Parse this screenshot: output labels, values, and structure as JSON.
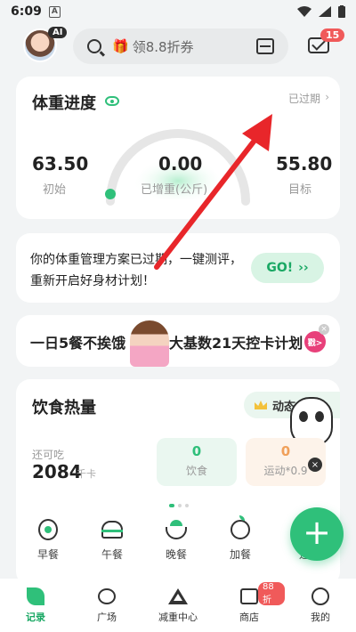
{
  "status_bar": {
    "time": "6:09"
  },
  "header": {
    "ai_badge": "AI",
    "search_placeholder": "领8.8折券",
    "mail_badge": "15"
  },
  "weight_card": {
    "title": "体重进度",
    "expired_link": "已过期",
    "initial_value": "63.50",
    "initial_label": "初始",
    "gained_value": "0.00",
    "gained_label": "已增重(公斤)",
    "target_value": "55.80",
    "target_label": "目标"
  },
  "plan_card": {
    "message": "你的体重管理方案已过期，一键测评，重新开启好身材计划！",
    "go_label": "GO!",
    "go_arrows": "››"
  },
  "banner": {
    "left_text": "一日5餐不挨饿",
    "right_text": "大基数21天控卡计划",
    "badge": "戳>"
  },
  "diet_card": {
    "title": "饮食热量",
    "dynamic_label": "动态",
    "remaining_label": "还可吃",
    "remaining_value": "2084",
    "remaining_unit": "千卡",
    "food_value": "0",
    "food_label": "饮食",
    "sport_value": "0",
    "sport_label": "运动*0.9",
    "meals": [
      "早餐",
      "午餐",
      "晚餐",
      "加餐",
      "运"
    ]
  },
  "fab_label": "+",
  "tabbar": {
    "tabs": [
      "记录",
      "广场",
      "减重中心",
      "商店",
      "我的"
    ],
    "shop_badge": "88折",
    "active_tab": "记录"
  },
  "colors": {
    "accent": "#2fc07a",
    "badge": "#f05a5a",
    "arrow": "#e8262a"
  }
}
